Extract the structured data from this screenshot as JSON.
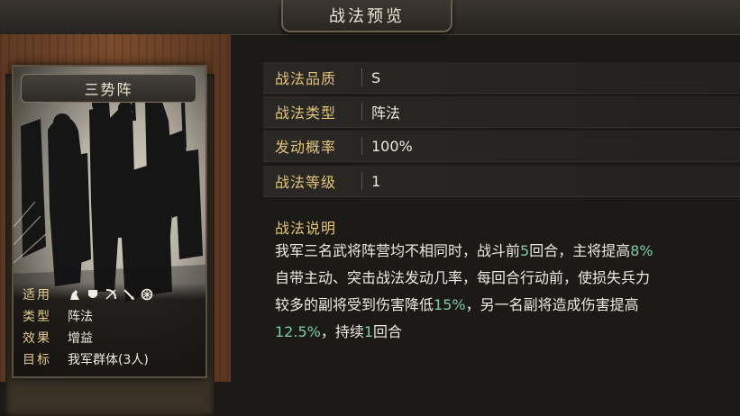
{
  "header": {
    "title": "战法预览"
  },
  "card": {
    "name": "三势阵",
    "info": [
      {
        "key": "适用",
        "icons": [
          "cavalry-icon",
          "shield-icon",
          "bow-icon",
          "spear-icon",
          "chariot-icon"
        ]
      },
      {
        "key": "类型",
        "value": "阵法"
      },
      {
        "key": "效果",
        "value": "增益"
      },
      {
        "key": "目标",
        "value": "我军群体(3人)"
      }
    ]
  },
  "properties": [
    {
      "label": "战法品质",
      "value": "S"
    },
    {
      "label": "战法类型",
      "value": "阵法"
    },
    {
      "label": "发动概率",
      "value": "100%"
    },
    {
      "label": "战法等级",
      "value": "1"
    }
  ],
  "description": {
    "title": "战法说明",
    "lines": [
      [
        {
          "t": "我军三名武将阵营均不相同时，战斗前"
        },
        {
          "t": "5",
          "h": true
        },
        {
          "t": "回合，主将提高"
        },
        {
          "t": "8%",
          "h": true
        }
      ],
      [
        {
          "t": "自带主动、突击战法发动几率，每回合行动前，使损失兵力"
        }
      ],
      [
        {
          "t": "较多的副将受到伤害降低"
        },
        {
          "t": "15%",
          "h": true
        },
        {
          "t": "，另一名副将造成伤害提高"
        }
      ],
      [
        {
          "t": "12.5%",
          "h": true
        },
        {
          "t": "，持续"
        },
        {
          "t": "1",
          "h": true
        },
        {
          "t": "回合"
        }
      ]
    ]
  },
  "colors": {
    "label_gold": "#e2c47b",
    "highlight_green": "#7fc9a6",
    "text": "#ede9df"
  }
}
